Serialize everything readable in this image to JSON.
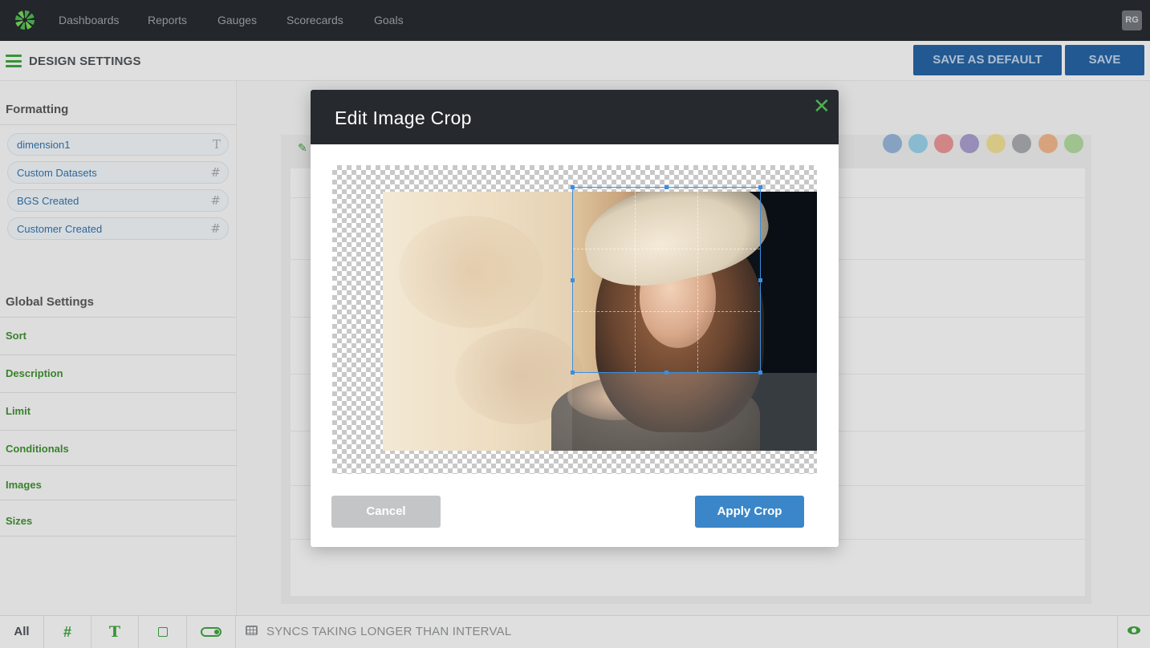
{
  "nav": {
    "links": [
      "Dashboards",
      "Reports",
      "Gauges",
      "Scorecards",
      "Goals"
    ],
    "avatar_initials": "RG"
  },
  "design_bar": {
    "title": "DESIGN SETTINGS",
    "save_default_label": "SAVE AS DEFAULT",
    "save_label": "SAVE"
  },
  "sidebar": {
    "formatting_heading": "Formatting",
    "fields": [
      {
        "label": "dimension1",
        "icon": "T"
      },
      {
        "label": "Custom Datasets",
        "icon": "#"
      },
      {
        "label": "BGS Created",
        "icon": "#"
      },
      {
        "label": "Customer Created",
        "icon": "#"
      }
    ],
    "global_heading": "Global Settings",
    "global_items": [
      "Sort",
      "Description",
      "Limit",
      "Conditionals",
      "Images",
      "Sizes"
    ]
  },
  "bottom_bar": {
    "all_label": "All",
    "hash_icon": "#",
    "text_icon": "T",
    "status_text": "SYNCS TAKING LONGER THAN INTERVAL"
  },
  "modal": {
    "title": "Edit Image Crop",
    "close_icon": "✕",
    "cancel_label": "Cancel",
    "apply_label": "Apply Crop"
  },
  "colors": {
    "accent_green": "#3d9c3d",
    "primary_blue": "#3a86c8",
    "dark_header": "#26292d"
  }
}
